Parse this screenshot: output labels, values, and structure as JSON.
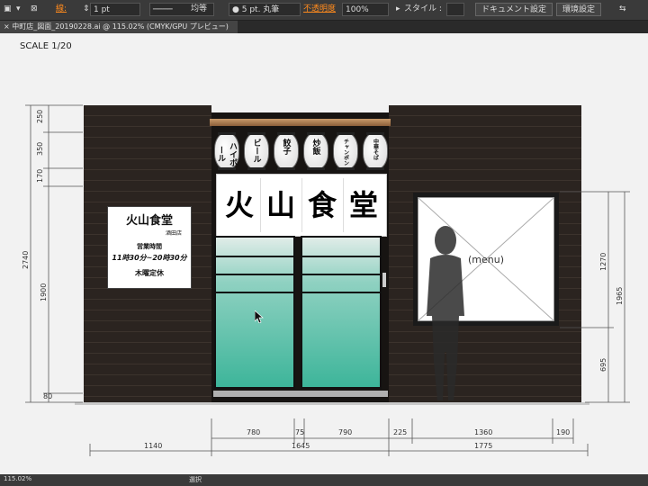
{
  "toolbar": {
    "stroke_label": "線:",
    "stroke_weight": "1 pt",
    "profile_label": "均等",
    "brush_label": "5 pt. 丸筆",
    "opacity_label": "不透明度",
    "opacity_value": "100%",
    "style_label": "スタイル :",
    "document_settings": "ドキュメント設定",
    "preferences": "環境設定"
  },
  "document_tab": {
    "title": "中町店_図面_20190228.ai @ 115.02% (CMYK/GPU プレビュー)"
  },
  "drawing": {
    "scale": "SCALE 1/20",
    "lanterns": [
      "ハイボール",
      "ビール",
      "餃子",
      "炒飯",
      "チャンポン",
      "中華そば"
    ],
    "noren": [
      "火",
      "山",
      "食",
      "堂"
    ],
    "sign": {
      "name": "火山食堂",
      "branch": "酒田店",
      "hours_label": "営業時間",
      "hours": "11時30分~20時30分",
      "closed": "木曜定休"
    },
    "menu_label": "(menu)",
    "dims_left": [
      "250",
      "350",
      "170",
      "2740",
      "1900",
      "80"
    ],
    "dims_right": [
      "1270",
      "1965",
      "695"
    ],
    "dims_bottom_top": [
      "780",
      "75",
      "790",
      "225",
      "1360",
      "190"
    ],
    "dims_bottom": [
      "1140",
      "1645",
      "1775"
    ]
  },
  "status": {
    "zoom": "115.02%",
    "tool": "選択"
  }
}
